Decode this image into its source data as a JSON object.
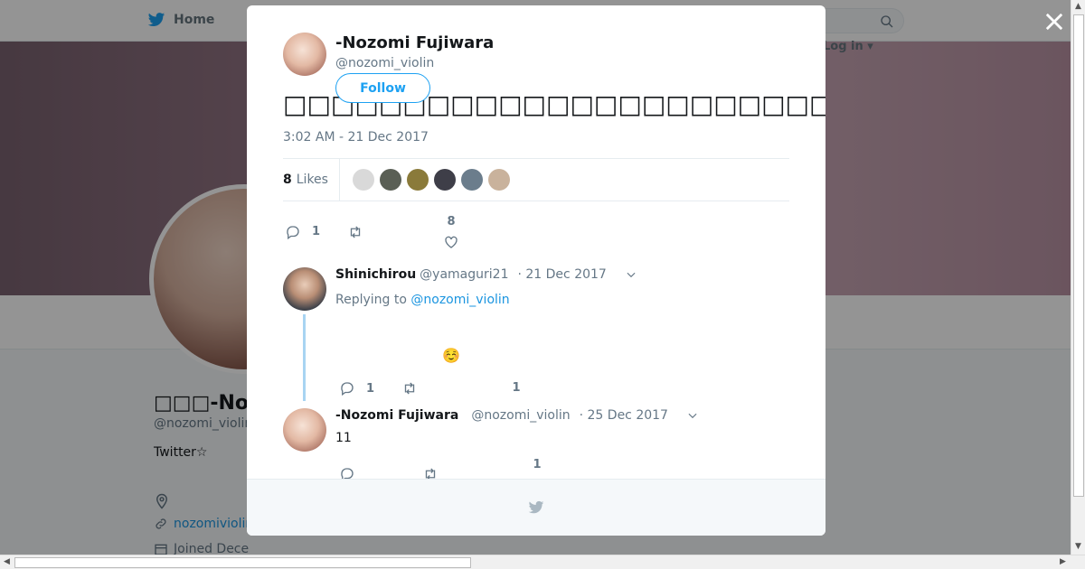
{
  "nav": {
    "home_label": "Home",
    "login_label": "Log in"
  },
  "background_profile": {
    "name": "□□□-Nozo",
    "handle": "@nozomi_violin",
    "bio": "Twitter☆",
    "url": "nozomiviolin",
    "joined": "Joined Dece"
  },
  "tweet": {
    "author_name": "-Nozomi Fujiwara",
    "author_handle": "@nozomi_violin",
    "follow_label": "Follow",
    "text": "□□□□□□□□□□□□□□□□□□□□□□□□□□□□□□□□□□□□□□□□□□□□□□□□□□□□□□□□□",
    "timestamp": "3:02 AM - 21 Dec 2017",
    "likes_count": "8",
    "likes_label": "Likes",
    "likers": [
      {
        "color": "#d9d9d9"
      },
      {
        "color": "#5a5f55"
      },
      {
        "color": "#8a7a3a"
      },
      {
        "color": "#3e3e48"
      },
      {
        "color": "#6b7d8c"
      },
      {
        "color": "#c9b29c"
      }
    ],
    "actions": {
      "replies": "1",
      "retweets": "",
      "likes": "8"
    }
  },
  "replies": [
    {
      "name": "Shinichirou",
      "handle": "@yamaguri21",
      "date": "· 21 Dec 2017",
      "replying_prefix": "Replying to",
      "replying_to": "@nozomi_violin",
      "text": "☺️",
      "actions": {
        "replies": "1",
        "retweets": "",
        "likes": "1"
      }
    },
    {
      "name": "-Nozomi Fujiwara",
      "handle": "@nozomi_violin",
      "date": "· 25 Dec 2017",
      "text": "11",
      "actions": {
        "replies": "",
        "retweets": "",
        "likes": "1"
      }
    }
  ],
  "colors": {
    "twitter_blue": "#1da1f2",
    "link": "#1b95e0",
    "muted": "#657786"
  }
}
